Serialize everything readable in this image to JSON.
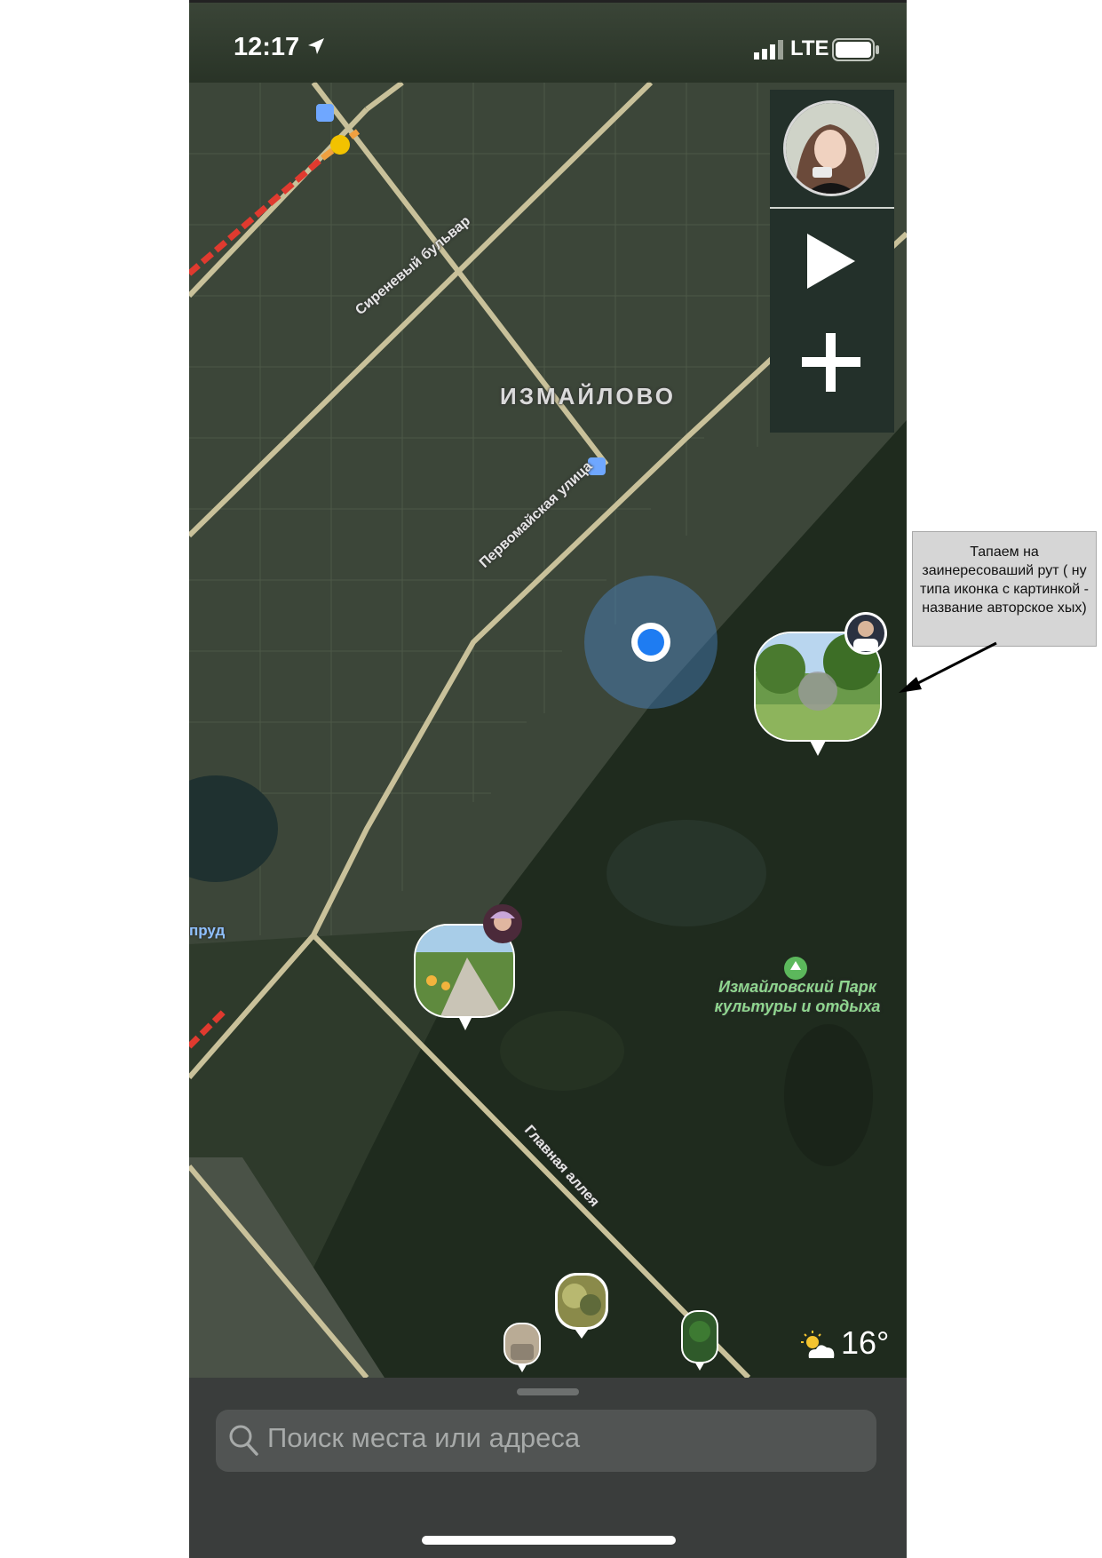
{
  "status_bar": {
    "time": "12:17",
    "network": "LTE",
    "icons": [
      "location-arrow-icon",
      "signal-icon",
      "battery-icon"
    ]
  },
  "side_panel": {
    "items": [
      "user-avatar",
      "play-button",
      "add-button"
    ]
  },
  "map": {
    "district": "ИЗМАЙЛОВО",
    "streets": [
      "Сиреневый бульвар",
      "Первомайская улица",
      "Главная аллея"
    ],
    "pond": "пруд",
    "park": "Измайловский Парк культуры и отдыха",
    "colors": {
      "forest": "#1f2b1e",
      "roads": "#c9c19a",
      "traffic": "#e03a2f",
      "location": "#1e7cf2",
      "park_label": "#8fd68f"
    }
  },
  "weather": {
    "temperature": "16°",
    "icon": "partly-cloudy-icon"
  },
  "search": {
    "placeholder": "Поиск места или адреса"
  },
  "annotation": {
    "text": "Тапаем на заинересоваший рут ( ну типа иконка с картинкой - название авторское хых)"
  }
}
